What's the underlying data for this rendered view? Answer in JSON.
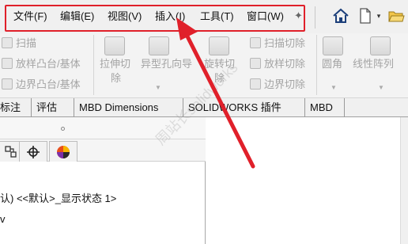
{
  "menubar": {
    "items": [
      "文件(F)",
      "编辑(E)",
      "视图(V)",
      "插入(I)",
      "工具(T)",
      "窗口(W)"
    ]
  },
  "toolbar": {
    "icons": [
      "home-icon",
      "new-document-icon",
      "chevron-down-icon",
      "open-folder-icon"
    ]
  },
  "ribbon": {
    "col1": [
      "扫描",
      "放样凸台/基体",
      "边界凸台/基体"
    ],
    "big_buttons": [
      {
        "line1": "拉伸切",
        "line2": "除"
      },
      {
        "line1": "异型孔向导",
        "line2": ""
      },
      {
        "line1": "旋转切",
        "line2": "除"
      }
    ],
    "col_cut": [
      "扫描切除",
      "放样切除",
      "边界切除"
    ],
    "fillet": "圆角",
    "pattern": "线性阵列"
  },
  "tabs": [
    "标注",
    "评估",
    "MBD Dimensions",
    "SOLIDWORKS 插件",
    "MBD"
  ],
  "panel": {
    "tree": [
      "认) <<默认>_显示状态 1>",
      "v"
    ]
  },
  "overlay": {
    "watermark": "周站长solidworks"
  },
  "colors": {
    "highlight": "#e0202a",
    "arrow": "#e0202a",
    "ribbon_disabled_text": "#a4a4a4"
  }
}
